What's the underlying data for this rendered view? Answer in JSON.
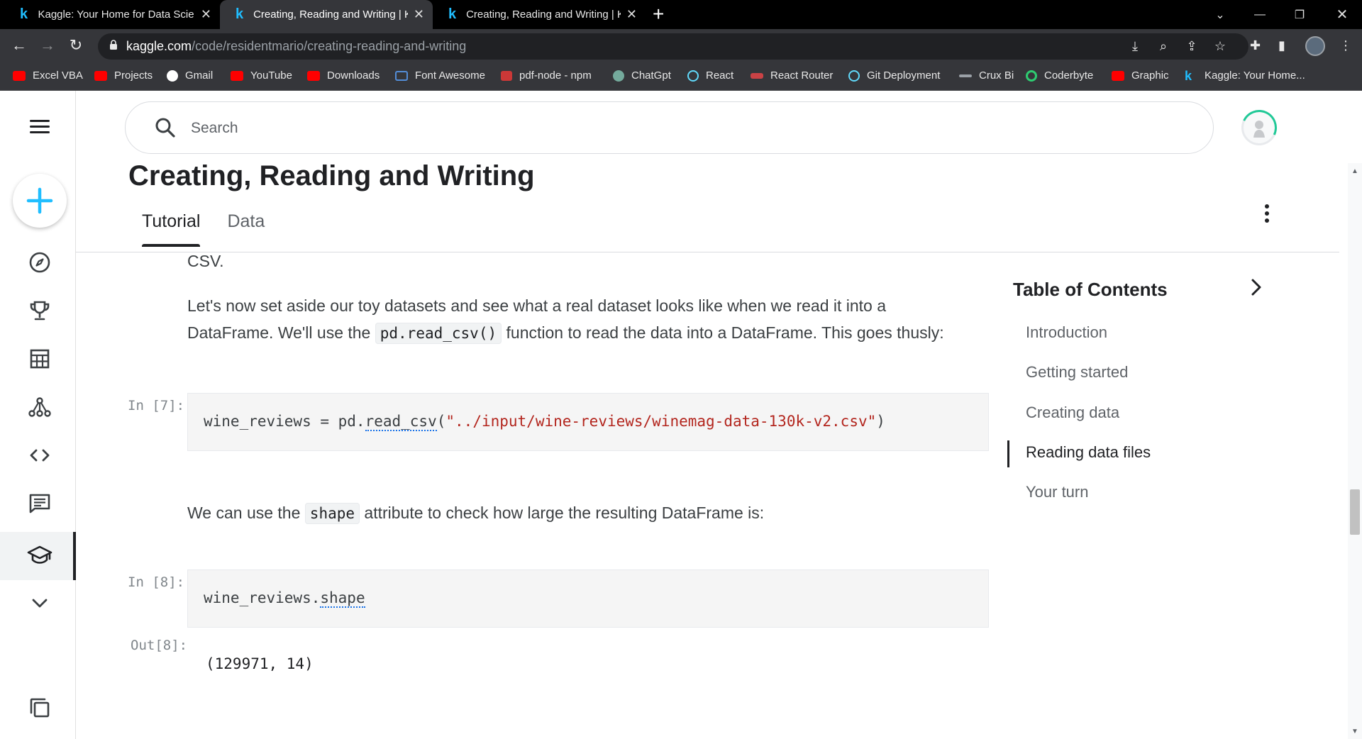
{
  "browser": {
    "tabs": [
      {
        "title": "Kaggle: Your Home for Data Scie",
        "active": false
      },
      {
        "title": "Creating, Reading and Writing | K",
        "active": true
      },
      {
        "title": "Creating, Reading and Writing | K",
        "active": false
      }
    ],
    "url_host": "kaggle.com",
    "url_path": "/code/residentmario/creating-reading-and-writing",
    "bookmarks": [
      {
        "label": "Excel VBA",
        "icon": "youtube-icon",
        "color": "#ff0000"
      },
      {
        "label": "Projects",
        "icon": "youtube-icon",
        "color": "#ff0000"
      },
      {
        "label": "Gmail",
        "icon": "google-icon",
        "color": "#ffffff"
      },
      {
        "label": "YouTube",
        "icon": "youtube-icon",
        "color": "#ff0000"
      },
      {
        "label": "Downloads",
        "icon": "youtube-icon",
        "color": "#ff0000"
      },
      {
        "label": "Font Awesome",
        "icon": "flag-icon",
        "color": "#538dd7"
      },
      {
        "label": "pdf-node - npm",
        "icon": "npm-icon",
        "color": "#cb3837"
      },
      {
        "label": "ChatGpt",
        "icon": "openai-icon",
        "color": "#74aa9c"
      },
      {
        "label": "React",
        "icon": "react-icon",
        "color": "#61dafb"
      },
      {
        "label": "React Router",
        "icon": "react-router-icon",
        "color": "#ca4245"
      },
      {
        "label": "Git Deployment",
        "icon": "react-icon",
        "color": "#61dafb"
      },
      {
        "label": "Crux Bi",
        "icon": "crux-icon",
        "color": "#9aa0a6"
      },
      {
        "label": "Coderbyte",
        "icon": "coderbyte-icon",
        "color": "#2ecc71"
      },
      {
        "label": "Graphic",
        "icon": "youtube-icon",
        "color": "#ff0000"
      },
      {
        "label": "Kaggle: Your Home...",
        "icon": "kaggle-icon",
        "color": "#20beff"
      }
    ]
  },
  "search": {
    "placeholder": "Search"
  },
  "notebook": {
    "title": "Creating, Reading and Writing",
    "tabs": [
      "Tutorial",
      "Data"
    ],
    "intro_fragment": "CSV.",
    "para1_a": "Let's now set aside our toy datasets and see what a real dataset looks like when we read it into a",
    "para1_b_pre": "DataFrame. We'll use the ",
    "para1_code": "pd.read_csv()",
    "para1_b_post": " function to read the data into a DataFrame. This goes thusly:",
    "cell7": {
      "prompt": "In [7]:",
      "code_prefix": "wine_reviews = pd.",
      "code_fn": "read_csv",
      "code_open": "(",
      "code_str": "\"../input/wine-reviews/winemag-data-130k-v2.csv\"",
      "code_close": ")"
    },
    "para2_pre": "We can use the ",
    "para2_code": "shape",
    "para2_post": " attribute to check how large the resulting DataFrame is:",
    "cell8": {
      "prompt": "In [8]:",
      "code_prefix": "wine_reviews.",
      "code_attr": "shape",
      "out_prompt": "Out[8]:",
      "output": "(129971, 14)"
    }
  },
  "toc": {
    "title": "Table of Contents",
    "items": [
      "Introduction",
      "Getting started",
      "Creating data",
      "Reading data files",
      "Your turn"
    ],
    "current": "Reading data files"
  }
}
